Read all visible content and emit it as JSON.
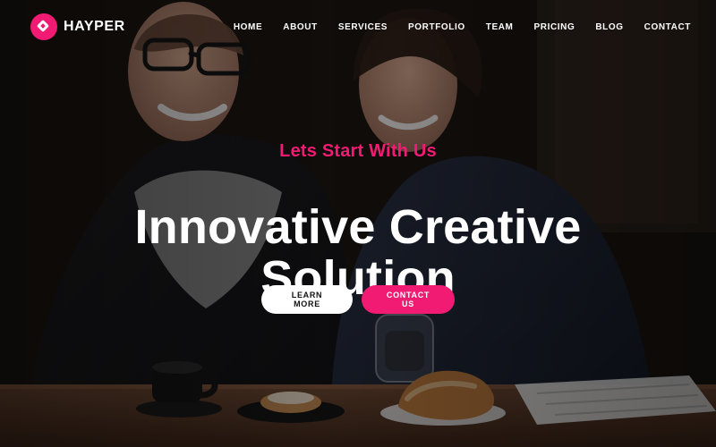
{
  "brand": {
    "name": "HAYPER",
    "logo_icon": "brand-logo-icon",
    "accent": "#f21b74"
  },
  "nav": {
    "items": [
      "HOME",
      "ABOUT",
      "SERVICES",
      "PORTFOLIO",
      "TEAM",
      "PRICING",
      "BLOG",
      "CONTACT"
    ]
  },
  "hero": {
    "kicker": "Lets Start With Us",
    "headline_line1": "Innovative Creative",
    "headline_line2": "Solution",
    "buttons": {
      "learn_more": "LEARN MORE",
      "contact_us": "CONTACT US"
    }
  }
}
